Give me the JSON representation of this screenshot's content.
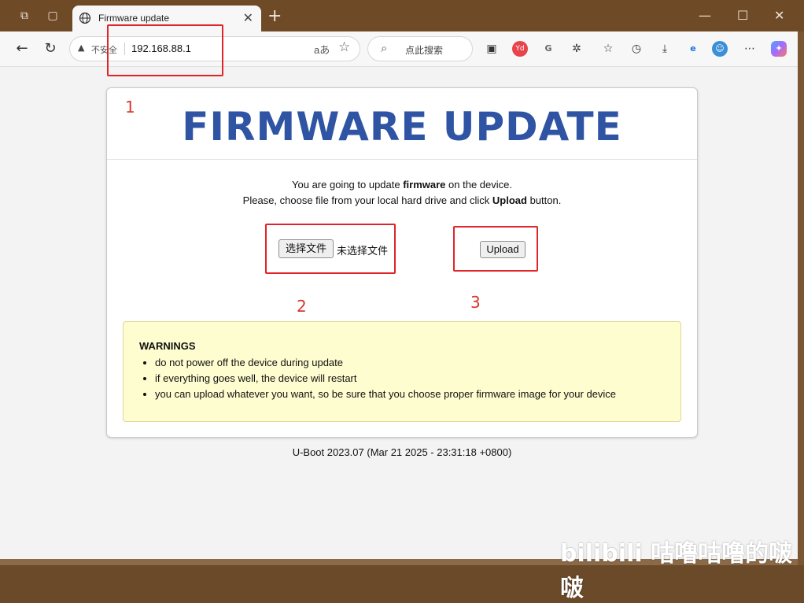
{
  "browser": {
    "tab_title": "Firmware update",
    "address_insecure_label": "不安全",
    "url": "192.168.88.1",
    "reader_label": "aあ",
    "search_placeholder": "点此搜索"
  },
  "page": {
    "heading": "FIRMWARE UPDATE",
    "intro_line1_pre": "You are going to update ",
    "intro_line1_bold": "firmware",
    "intro_line1_post": " on the device.",
    "intro_line2_pre": "Please, choose file from your local hard drive and click ",
    "intro_line2_bold": "Upload",
    "intro_line2_post": " button.",
    "choose_file_button": "选择文件",
    "no_file_text": "未选择文件",
    "upload_button": "Upload",
    "warnings_title": "WARNINGS",
    "warnings": [
      "do not power off the device during update",
      "if everything goes well, the device will restart",
      "you can upload whatever you want, so be sure that you choose proper firmware image for your device"
    ],
    "footer": "U-Boot 2023.07 (Mar 21 2025 - 23:31:18 +0800)"
  },
  "annotations": {
    "labels": [
      "1",
      "2",
      "3"
    ],
    "color": "#e0242a"
  },
  "watermark": "bilibili 咕噜咕噜的啵啵",
  "colors": {
    "heading": "#2f54a3",
    "warning_bg": "#fefdd0",
    "titlebar": "#6e4a26"
  }
}
